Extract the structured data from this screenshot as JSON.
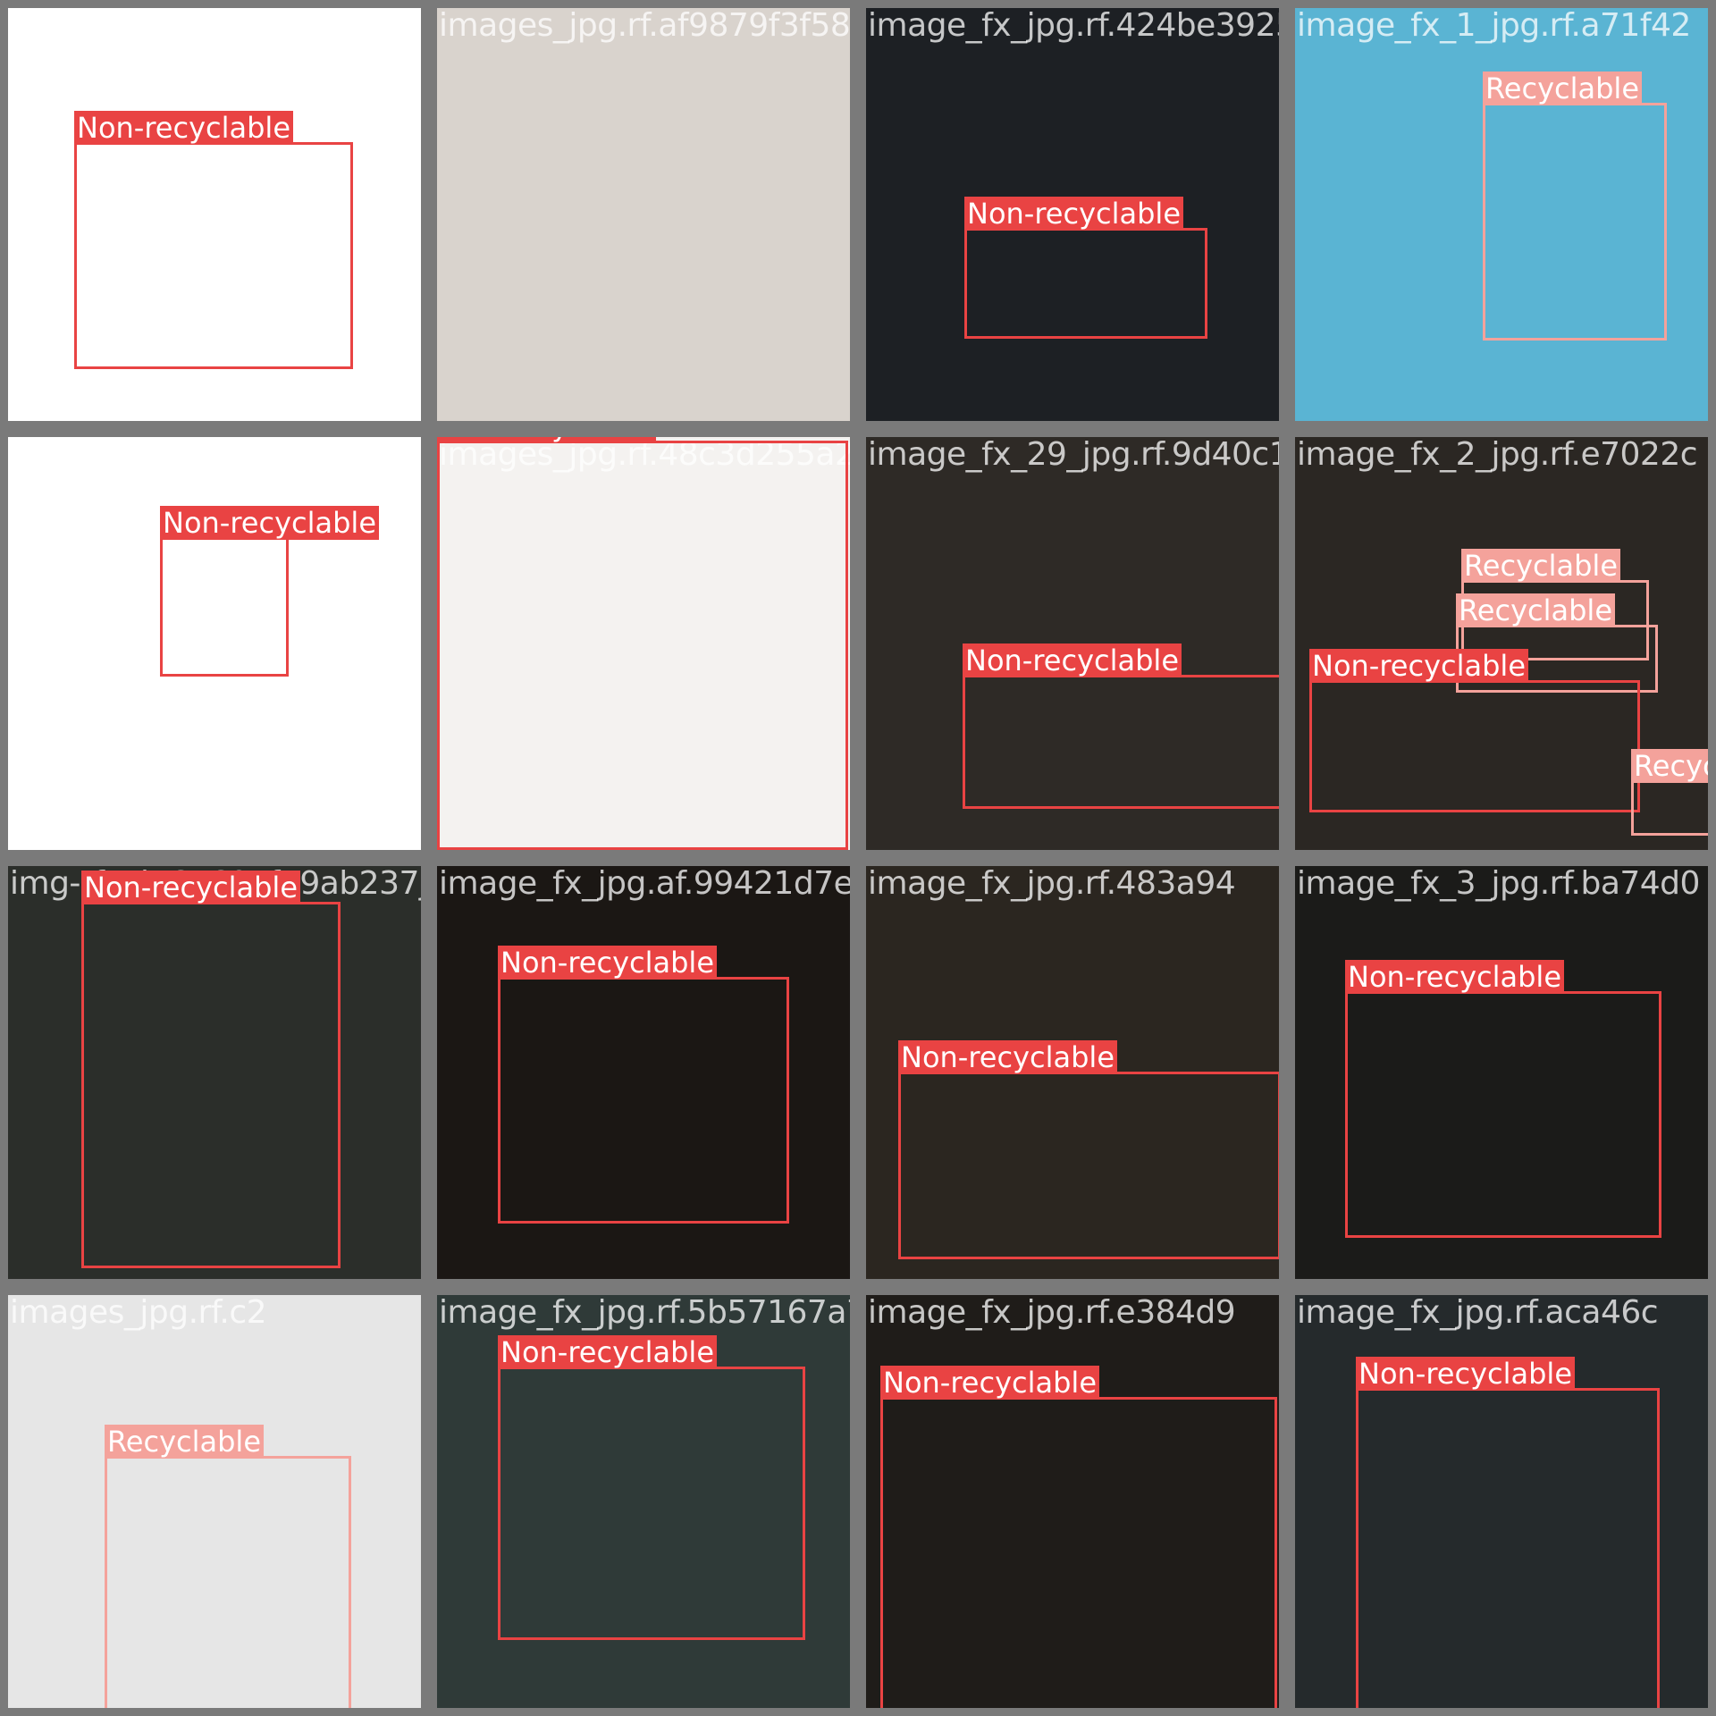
{
  "colors": {
    "non_recyclable": "#e94343",
    "recyclable": "#f4a29b",
    "tile_border": "#7a7a7a"
  },
  "tiles": [
    {
      "file": "istockphoto-121343453-612x612_jpg.rf.793c8ceba854",
      "bg": "#ffffff",
      "boxes": [
        {
          "label": "Non-recyclable",
          "cls": "non"
        }
      ]
    },
    {
      "file": "images_jpg.rf.af9879f3f58f",
      "bg": "#d9d3cd",
      "boxes": []
    },
    {
      "file": "image_fx_jpg.rf.424be3925",
      "bg": "#1d2024",
      "boxes": [
        {
          "label": "Non-recyclable",
          "cls": "non"
        }
      ]
    },
    {
      "file": "image_fx_1_jpg.rf.a71f42",
      "bg": "#5ab4d3",
      "boxes": [
        {
          "label": "Recyclable",
          "cls": "rec"
        }
      ]
    },
    {
      "file": "istockphoto-1045742132-612x612_jpg.rf.48c3d255a2",
      "bg": "#ffffff",
      "boxes": [
        {
          "label": "Non-recyclable",
          "cls": "non"
        }
      ]
    },
    {
      "file": "images_jpg.rf.48c3d255a27b",
      "bg": "#f4f2f0",
      "boxes": [
        {
          "label": "Non-recyclable",
          "cls": "non"
        }
      ]
    },
    {
      "file": "image_fx_29_jpg.rf.9d40c1",
      "bg": "#2e2a26",
      "boxes": [
        {
          "label": "Non-recyclable",
          "cls": "non"
        }
      ]
    },
    {
      "file": "image_fx_2_jpg.rf.e7022c",
      "bg": "#2b2723",
      "boxes": [
        {
          "label": "Recyclable",
          "cls": "rec"
        },
        {
          "label": "Recyclable",
          "cls": "rec"
        },
        {
          "label": "Non-recyclable",
          "cls": "non"
        },
        {
          "label": "Recyclable",
          "cls": "rec"
        }
      ]
    },
    {
      "file": "img-rf.cd761607f19ab237jpg.af.99421d7ef5",
      "bg": "#2b2e2a",
      "boxes": [
        {
          "label": "Non-recyclable",
          "cls": "non"
        }
      ]
    },
    {
      "file": "image_fx_jpg.af.99421d7ef5",
      "bg": "#1b1714",
      "boxes": [
        {
          "label": "Non-recyclable",
          "cls": "non"
        }
      ]
    },
    {
      "file": "image_fx_jpg.rf.483a94",
      "bg": "#2b2620",
      "boxes": [
        {
          "label": "Non-recyclable",
          "cls": "non"
        }
      ]
    },
    {
      "file": "image_fx_3_jpg.rf.ba74d0",
      "bg": "#1b1b19",
      "boxes": [
        {
          "label": "Non-recyclable",
          "cls": "non"
        }
      ]
    },
    {
      "file": "images_jpg.rf.c2",
      "bg": "#e6e6e6",
      "boxes": [
        {
          "label": "Recyclable",
          "cls": "rec"
        }
      ]
    },
    {
      "file": "image_fx_jpg.rf.5b57167a7",
      "bg": "#2f3a38",
      "boxes": [
        {
          "label": "Non-recyclable",
          "cls": "non"
        }
      ]
    },
    {
      "file": "image_fx_jpg.rf.e384d9",
      "bg": "#1f1c19",
      "boxes": [
        {
          "label": "Non-recyclable",
          "cls": "non"
        }
      ]
    },
    {
      "file": "image_fx_jpg.rf.aca46c",
      "bg": "#252a2c",
      "boxes": [
        {
          "label": "Non-recyclable",
          "cls": "non"
        }
      ]
    }
  ]
}
